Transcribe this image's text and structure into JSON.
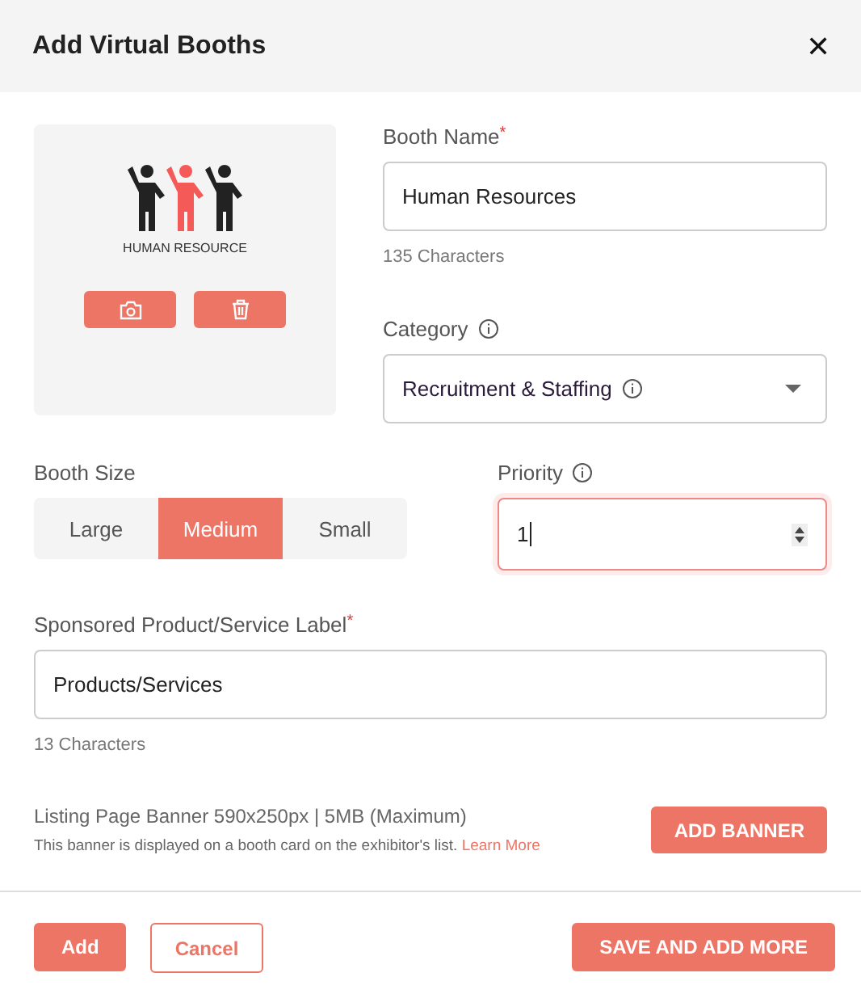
{
  "dialog": {
    "title": "Add Virtual Booths",
    "close": "✕"
  },
  "logo": {
    "caption": "HUMAN RESOURCE"
  },
  "booth_name": {
    "label": "Booth Name",
    "required_mark": "*",
    "value": "Human Resources",
    "hint": "135 Characters"
  },
  "category": {
    "label": "Category",
    "value": "Recruitment & Staffing"
  },
  "booth_size": {
    "label": "Booth Size",
    "options": [
      {
        "label": "Large",
        "selected": false
      },
      {
        "label": "Medium",
        "selected": true
      },
      {
        "label": "Small",
        "selected": false
      }
    ]
  },
  "priority": {
    "label": "Priority",
    "value": "1",
    "focused": true
  },
  "sponsored_label": {
    "label": "Sponsored Product/Service Label",
    "required_mark": "*",
    "value": "Products/Services",
    "hint": "13 Characters"
  },
  "banner": {
    "title": "Listing Page Banner 590x250px | 5MB (Maximum)",
    "description": "This banner is displayed on a booth card on the exhibitor's list.",
    "link": "Learn More",
    "button": "ADD BANNER"
  },
  "footer": {
    "add": "Add",
    "cancel": "Cancel",
    "save_more": "SAVE AND ADD MORE"
  }
}
